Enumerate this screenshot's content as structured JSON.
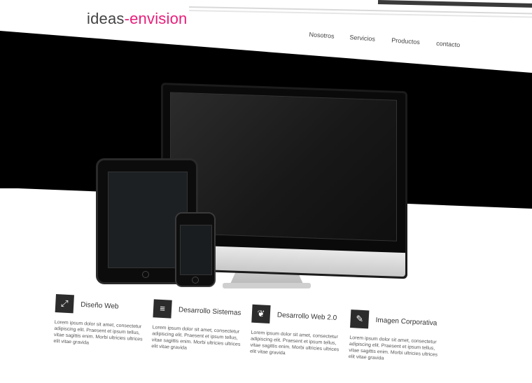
{
  "logo": {
    "part1": "ideas",
    "dash": "-",
    "part2": "envision"
  },
  "nav": {
    "items": [
      "Nosotros",
      "Servicios",
      "Productos",
      "contacto"
    ]
  },
  "features": [
    {
      "icon": "expand-icon",
      "title": "Diseño Web",
      "desc": "Lorem ipsum dolor sit amet, consectetur adipiscing elit. Praesent et ipsum tellus, vitae sagittis enim. Morbi ultricies ultrices elit vitae gravida"
    },
    {
      "icon": "list-icon",
      "title": "Desarrollo Sistemas",
      "desc": "Lorem ipsum dolor sit amet, consectetur adipiscing elit. Praesent et ipsum tellus, vitae sagittis enim. Morbi ultricies ultrices elit vitae gravida"
    },
    {
      "icon": "leaf-icon",
      "title": "Desarrollo Web 2.0",
      "desc": "Lorem ipsum dolor sit amet, consectetur adipiscing elit. Praesent et ipsum tellus, vitae sagittis enim. Morbi ultricies ultrices elit vitae gravida"
    },
    {
      "icon": "pencil-icon",
      "title": "Imagen Corporativa",
      "desc": "Lorem ipsum dolor sit amet, consectetur adipiscing elit. Praesent et ipsum tellus, vitae sagittis enim. Morbi ultricies ultrices elit vitae gravida"
    }
  ],
  "colors": {
    "accent": "#e91e7a",
    "hero": "#000000",
    "icon_bg": "#2c2c2c"
  }
}
